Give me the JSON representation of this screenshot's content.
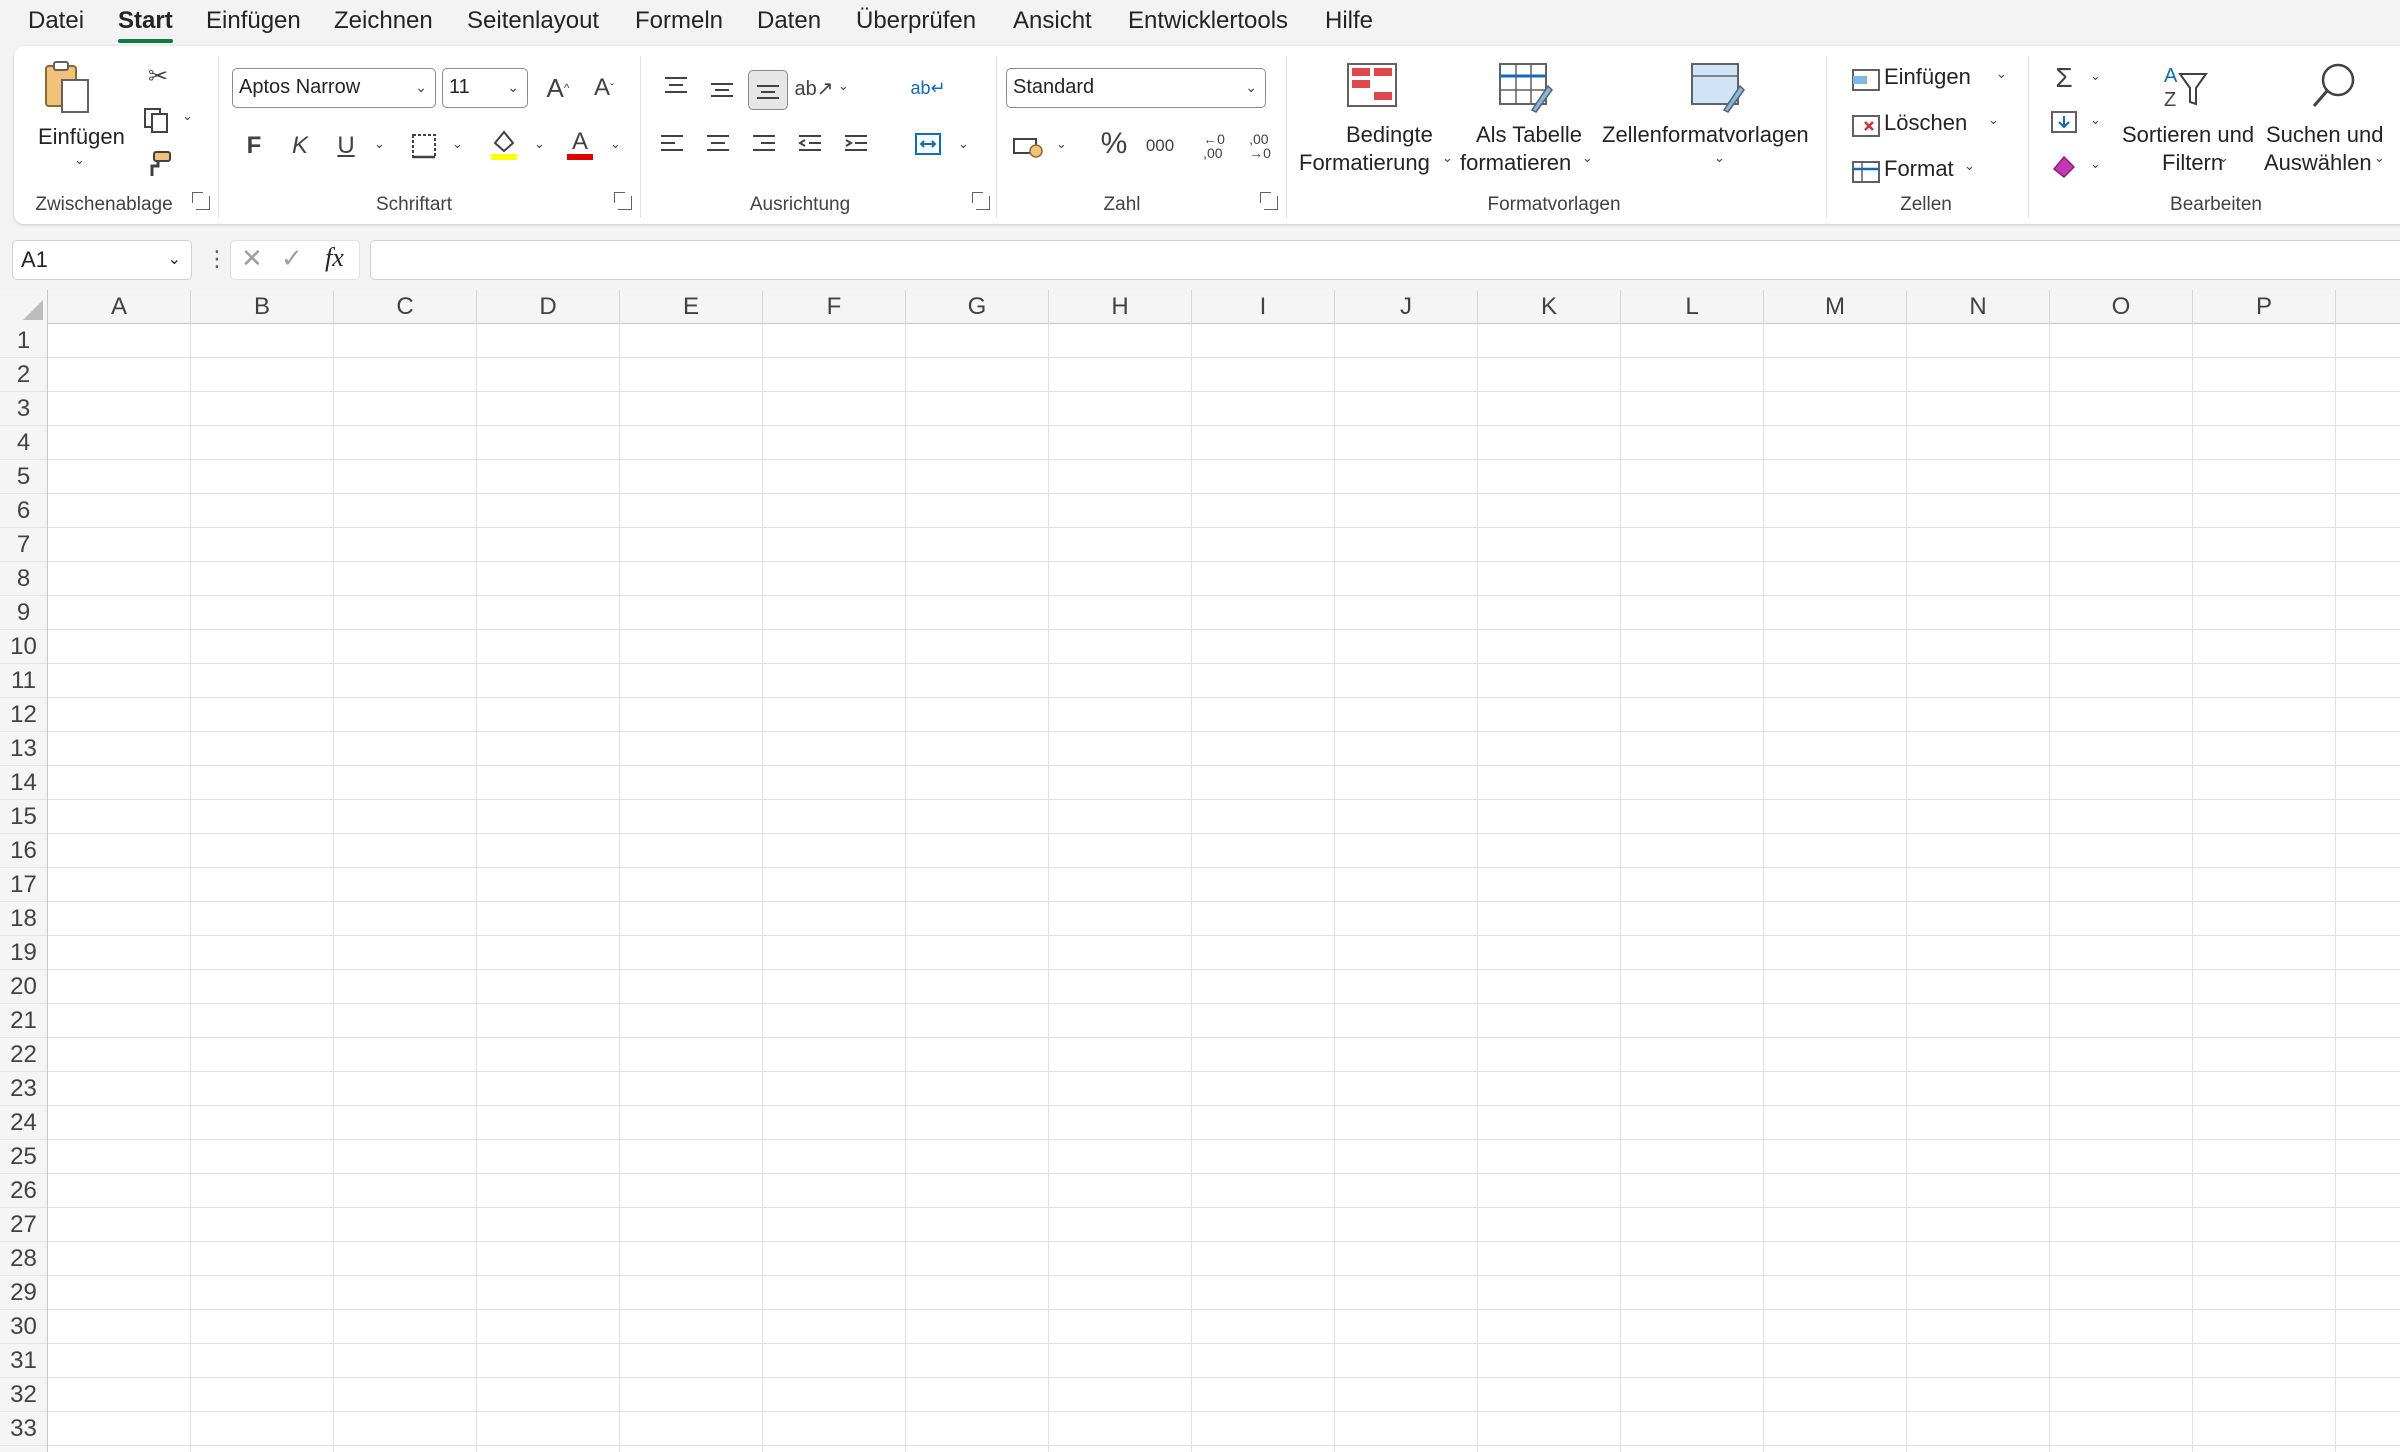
{
  "menu": {
    "tabs": [
      "Datei",
      "Start",
      "Einfügen",
      "Zeichnen",
      "Seitenlayout",
      "Formeln",
      "Daten",
      "Überprüfen",
      "Ansicht",
      "Entwicklertools",
      "Hilfe"
    ],
    "active": "Start"
  },
  "ribbon": {
    "clipboard": {
      "paste_label": "Einfügen",
      "group_label": "Zwischenablage"
    },
    "font": {
      "font_name": "Aptos Narrow",
      "font_size": "11",
      "bold": "F",
      "italic": "K",
      "underline": "U",
      "group_label": "Schriftart",
      "highlight_color": "#ffff00",
      "font_color": "#e00000"
    },
    "alignment": {
      "group_label": "Ausrichtung"
    },
    "number": {
      "format": "Standard",
      "percent": "%",
      "thousands": "000",
      "group_label": "Zahl"
    },
    "styles": {
      "conditional_line1": "Bedingte",
      "conditional_line2": "Formatierung",
      "table_line1": "Als Tabelle",
      "table_line2": "formatieren",
      "cell_styles": "Zellenformatvorlagen",
      "group_label": "Formatvorlagen"
    },
    "cells": {
      "insert": "Einfügen",
      "delete": "Löschen",
      "format": "Format",
      "group_label": "Zellen"
    },
    "editing": {
      "sort_line1": "Sortieren und",
      "sort_line2": "Filtern",
      "find_line1": "Suchen und",
      "find_line2": "Auswählen",
      "group_label": "Bearbeiten"
    }
  },
  "formula_bar": {
    "name_box": "A1",
    "fx": "fx",
    "value": ""
  },
  "sheet": {
    "columns": [
      "A",
      "B",
      "C",
      "D",
      "E",
      "F",
      "G",
      "H",
      "I",
      "J",
      "K",
      "L",
      "M",
      "N",
      "O",
      "P"
    ],
    "rows": [
      "1",
      "2",
      "3",
      "4",
      "5",
      "6",
      "7",
      "8",
      "9",
      "10",
      "11",
      "12",
      "13",
      "14",
      "15",
      "16",
      "17",
      "18",
      "19",
      "20",
      "21",
      "22",
      "23",
      "24",
      "25",
      "26",
      "27",
      "28",
      "29",
      "30",
      "31",
      "32",
      "33"
    ]
  }
}
